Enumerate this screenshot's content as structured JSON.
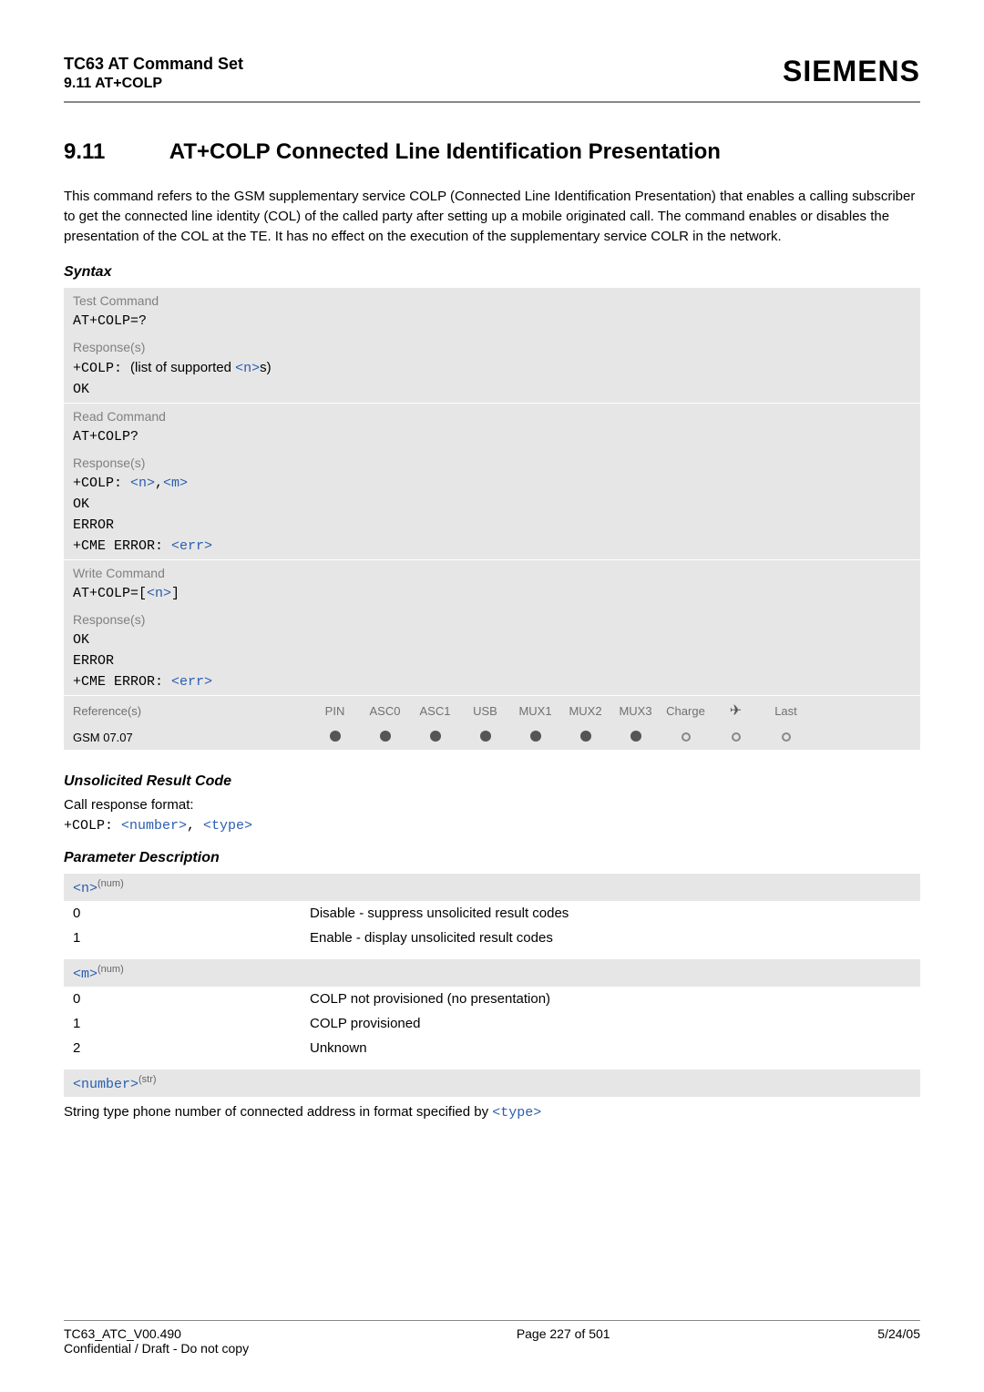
{
  "header": {
    "product": "TC63 AT Command Set",
    "section_ref": "9.11 AT+COLP",
    "brand": "SIEMENS"
  },
  "section": {
    "number": "9.11",
    "title": "AT+COLP   Connected Line Identification Presentation",
    "intro": "This command refers to the GSM supplementary service COLP (Connected Line Identification Presentation) that enables a calling subscriber to get the connected line identity (COL) of the called party after setting up a mobile originated call. The command enables or disables the presentation of the COL at the TE. It has no effect on the execution of the supplementary service COLR in the network."
  },
  "syntax_label": "Syntax",
  "blocks": {
    "test": {
      "label": "Test Command",
      "cmd": "AT+COLP=?",
      "resp_label": "Response(s)",
      "resp_prefix": "+COLP:",
      "resp_mid1": "(list of supported ",
      "resp_n": "<n>",
      "resp_mid2": "s)",
      "ok": "OK"
    },
    "read": {
      "label": "Read Command",
      "cmd": "AT+COLP?",
      "resp_label": "Response(s)",
      "line_prefix": "+COLP: ",
      "n": "<n>",
      "comma": ",",
      "m": "<m>",
      "ok": "OK",
      "error": "ERROR",
      "cme": "+CME ERROR: ",
      "err": "<err>"
    },
    "write": {
      "label": "Write Command",
      "cmd_prefix": "AT+COLP=[",
      "n": "<n>",
      "cmd_suffix": "]",
      "resp_label": "Response(s)",
      "ok": "OK",
      "error": "ERROR",
      "cme": "+CME ERROR: ",
      "err": "<err>"
    }
  },
  "ref": {
    "label": "Reference(s)",
    "value": "GSM 07.07",
    "cols": [
      "PIN",
      "ASC0",
      "ASC1",
      "USB",
      "MUX1",
      "MUX2",
      "MUX3",
      "Charge",
      "✈",
      "Last"
    ]
  },
  "urc": {
    "heading": "Unsolicited Result Code",
    "desc": "Call response format:",
    "prefix": "+COLP: ",
    "number": "<number>",
    "comma": ", ",
    "type": "<type>"
  },
  "params": {
    "heading": "Parameter Description",
    "n": {
      "tag": "<n>",
      "sup": "(num)",
      "rows": [
        {
          "k": "0",
          "v": "Disable - suppress unsolicited result codes"
        },
        {
          "k": "1",
          "v": "Enable - display unsolicited result codes"
        }
      ]
    },
    "m": {
      "tag": "<m>",
      "sup": "(num)",
      "rows": [
        {
          "k": "0",
          "v": "COLP not provisioned (no presentation)"
        },
        {
          "k": "1",
          "v": "COLP provisioned"
        },
        {
          "k": "2",
          "v": "Unknown"
        }
      ]
    },
    "number": {
      "tag": "<number>",
      "sup": "(str)",
      "note_pre": "String type phone number of connected address in format specified by ",
      "note_link": "<type>"
    }
  },
  "footer": {
    "doc": "TC63_ATC_V00.490",
    "conf": "Confidential / Draft - Do not copy",
    "page": "Page 227 of 501",
    "date": "5/24/05"
  }
}
